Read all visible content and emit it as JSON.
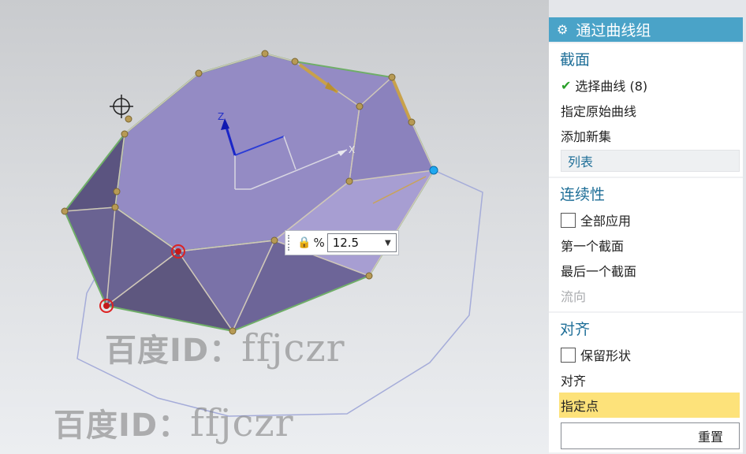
{
  "viewport": {
    "watermark_1": "百度ID：",
    "watermark_1_tail": "ffjczr",
    "watermark_2": "百度ID：",
    "watermark_2_tail": "ffjczr",
    "percent_symbol": "%",
    "percent_value": "12.5",
    "axis_labels": {
      "z": "Z",
      "x": "X"
    },
    "colors": {
      "surface": "#8f86c2",
      "edge": "#6fae68",
      "guide": "#a5acd9"
    }
  },
  "panel": {
    "title": "通过曲线组",
    "sections": {
      "section": {
        "title": "截面",
        "select_curve": "选择曲线 (8)",
        "specify_origin": "指定原始曲线",
        "add_new_set": "添加新集",
        "list": "列表"
      },
      "continuity": {
        "title": "连续性",
        "apply_all": "全部应用",
        "first_section": "第一个截面",
        "last_section": "最后一个截面",
        "flow_direction": "流向"
      },
      "alignment": {
        "title": "对齐",
        "keep_shape": "保留形状",
        "align": "对齐",
        "specify_point": "指定点",
        "reset": "重置"
      }
    },
    "accent_color": "#4aa3c8"
  }
}
